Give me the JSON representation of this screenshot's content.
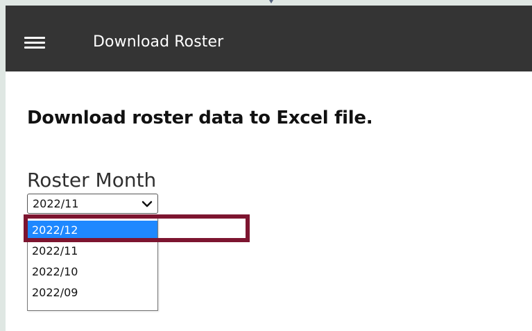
{
  "header": {
    "title": "Download Roster",
    "menu_icon": "hamburger-menu-icon"
  },
  "main": {
    "heading": "Download roster data to Excel file.",
    "field_label": "Roster Month",
    "select": {
      "selected_value": "2022/11",
      "options": [
        {
          "label": "2022/12",
          "highlighted": true
        },
        {
          "label": "2022/11",
          "highlighted": false
        },
        {
          "label": "2022/10",
          "highlighted": false
        },
        {
          "label": "2022/09",
          "highlighted": false
        }
      ]
    }
  },
  "colors": {
    "appbar_bg": "#343434",
    "option_highlight": "#1e88ff",
    "annotation_box": "#7d1530",
    "outer_bg": "#dfe7e3"
  }
}
